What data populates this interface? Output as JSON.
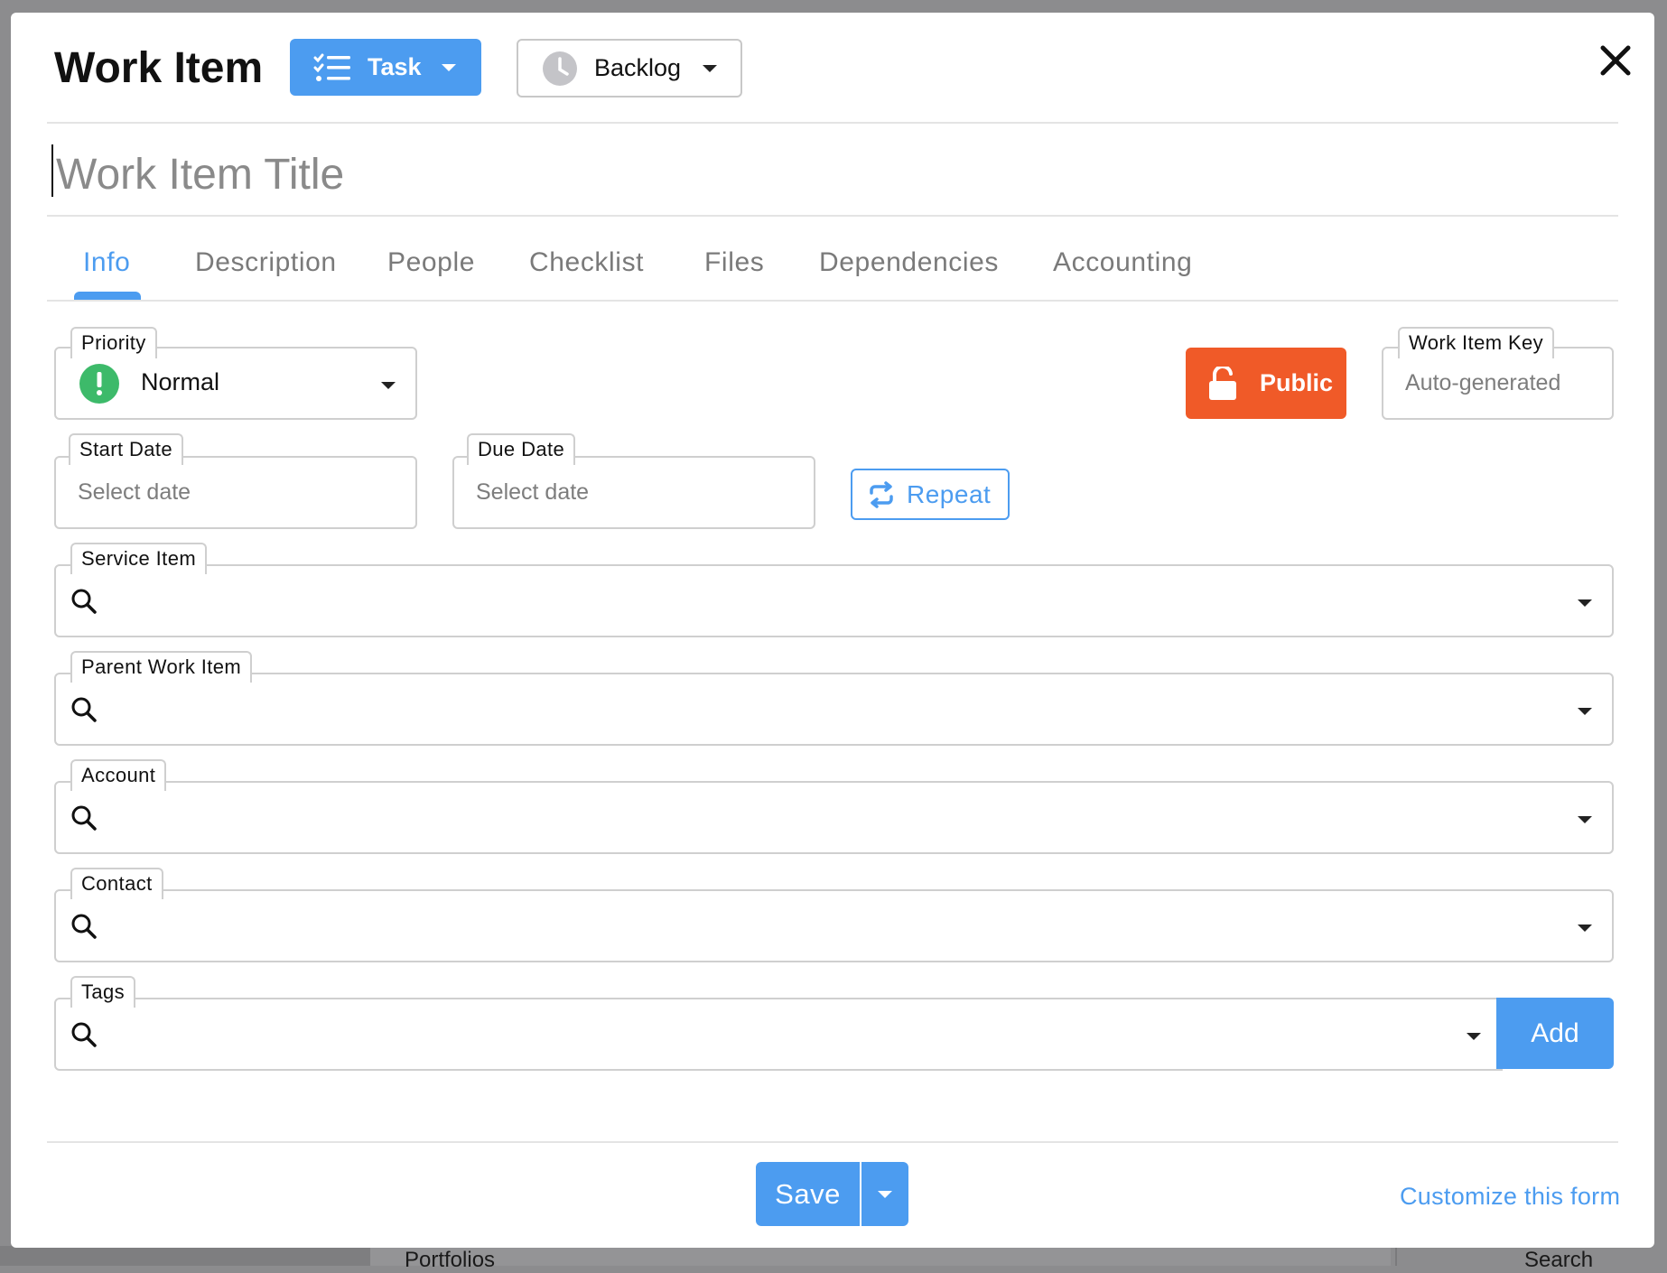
{
  "background": {
    "left_text": "Portfolios",
    "right_text": "Search"
  },
  "header": {
    "title": "Work Item",
    "type_button": {
      "label": "Task",
      "icon": "checklist-icon"
    },
    "status_button": {
      "label": "Backlog",
      "icon": "clock-icon"
    },
    "close_icon": "close-icon"
  },
  "title_field": {
    "placeholder": "Work Item Title",
    "value": ""
  },
  "tabs": [
    {
      "label": "Info",
      "active": true
    },
    {
      "label": "Description",
      "active": false
    },
    {
      "label": "People",
      "active": false
    },
    {
      "label": "Checklist",
      "active": false
    },
    {
      "label": "Files",
      "active": false
    },
    {
      "label": "Dependencies",
      "active": false
    },
    {
      "label": "Accounting",
      "active": false
    }
  ],
  "fields": {
    "priority": {
      "label": "Priority",
      "value": "Normal",
      "icon": "exclamation-circle-icon"
    },
    "work_item_key": {
      "label": "Work Item Key",
      "placeholder": "Auto-generated"
    },
    "start_date": {
      "label": "Start Date",
      "placeholder": "Select date"
    },
    "due_date": {
      "label": "Due Date",
      "placeholder": "Select date"
    },
    "service_item": {
      "label": "Service Item",
      "value": ""
    },
    "parent_work_item": {
      "label": "Parent Work Item",
      "value": ""
    },
    "account": {
      "label": "Account",
      "value": ""
    },
    "contact": {
      "label": "Contact",
      "value": ""
    },
    "tags": {
      "label": "Tags",
      "value": ""
    }
  },
  "buttons": {
    "public": "Public",
    "repeat": "Repeat",
    "add": "Add",
    "save": "Save",
    "customize": "Customize this form"
  },
  "colors": {
    "accent": "#4c9cf0",
    "public": "#f05a28",
    "priority_normal": "#3dba6a"
  }
}
